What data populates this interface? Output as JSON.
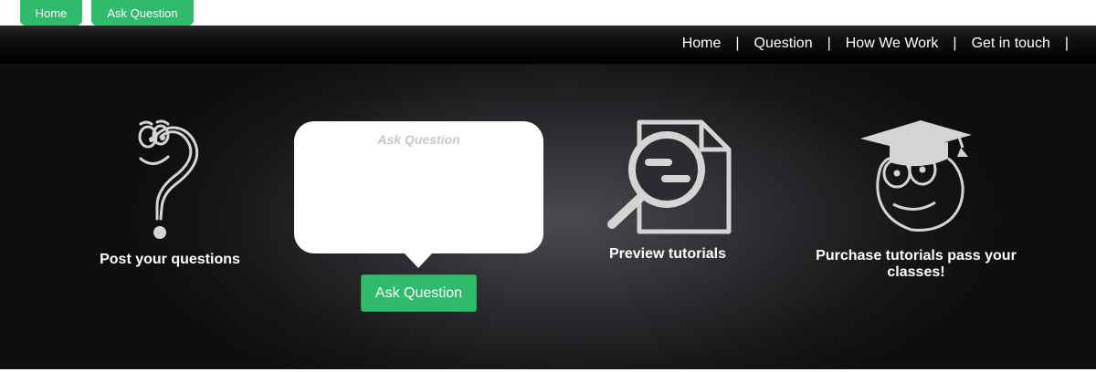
{
  "top_tabs": {
    "home": "Home",
    "ask_question": "Ask Question"
  },
  "nav": {
    "items": [
      "Home",
      "Question",
      "How We Work",
      "Get in touch"
    ],
    "separator": "|"
  },
  "features": {
    "post": {
      "label": "Post your questions",
      "icon": "question-mark-face-icon"
    },
    "preview": {
      "label": "Preview tutorials",
      "icon": "magnifier-document-icon"
    },
    "purchase": {
      "label": "Purchase tutorials pass your classes!",
      "icon": "graduate-face-icon"
    }
  },
  "ask_box": {
    "placeholder": "Ask Question",
    "button_label": "Ask Question"
  },
  "colors": {
    "accent_green": "#2fbb6b",
    "navbar": "#000000",
    "icon_gray": "#d4d4d4"
  }
}
